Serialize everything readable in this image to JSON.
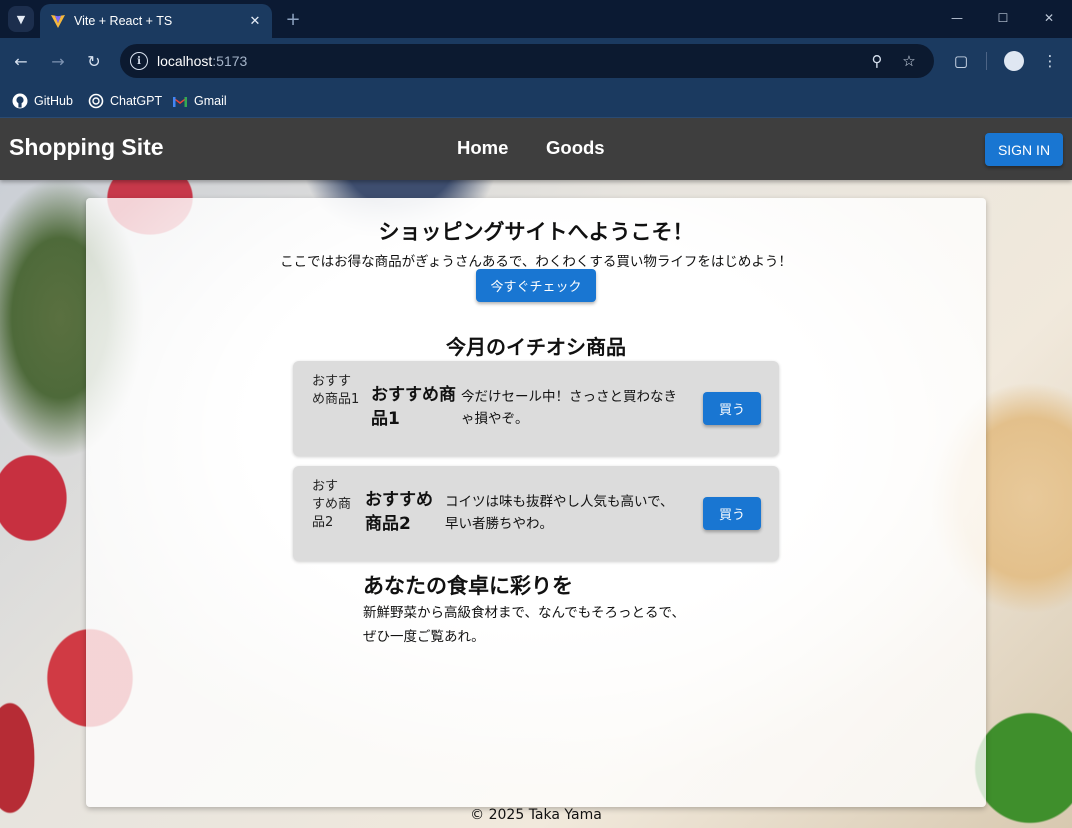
{
  "browser": {
    "tab_title": "Vite + React + TS",
    "url_host": "localhost",
    "url_port": ":5173",
    "bookmarks": [
      {
        "label": "GitHub",
        "icon": "github-icon"
      },
      {
        "label": "ChatGPT",
        "icon": "chatgpt-icon"
      },
      {
        "label": "Gmail",
        "icon": "gmail-icon"
      }
    ]
  },
  "header": {
    "brand": "Shopping Site",
    "nav": [
      {
        "label": "Home"
      },
      {
        "label": "Goods"
      }
    ],
    "signin_label": "SIGN IN"
  },
  "hero": {
    "title": "ショッピングサイトへようこそ！",
    "subtitle": "ここではお得な商品がぎょうさんあるで、わくわくする買い物ライフをはじめよう！",
    "cta_label": "今すぐチェック"
  },
  "featured": {
    "title": "今月のイチオシ商品",
    "items": [
      {
        "img_alt_lines": [
          "おすす",
          "め商品1"
        ],
        "name_lines": [
          "おすすめ商",
          "品1"
        ],
        "desc_lines": [
          "今だけセール中！さっさと買わなき",
          "ゃ損やぞ。"
        ],
        "buy_label": "買う"
      },
      {
        "img_alt_lines": [
          "おす",
          "すめ商",
          "品2"
        ],
        "name_lines": [
          "おすすめ",
          "商品2"
        ],
        "desc_lines": [
          "コイツは味も抜群やし人気も高いで、",
          "早い者勝ちやわ。"
        ],
        "buy_label": "買う"
      }
    ]
  },
  "promo": {
    "title": "あなたの食卓に彩りを",
    "text_lines": [
      "新鮮野菜から高級食材まで、なんでもそろっとるで、",
      "ぜひ一度ご覧あれ。"
    ]
  },
  "footer": {
    "copyright": "© 2025 Taka Yama"
  },
  "colors": {
    "appbar": "#3e3e3e",
    "primary_button": "#1976d2",
    "item_card": "#dcdcdc"
  }
}
